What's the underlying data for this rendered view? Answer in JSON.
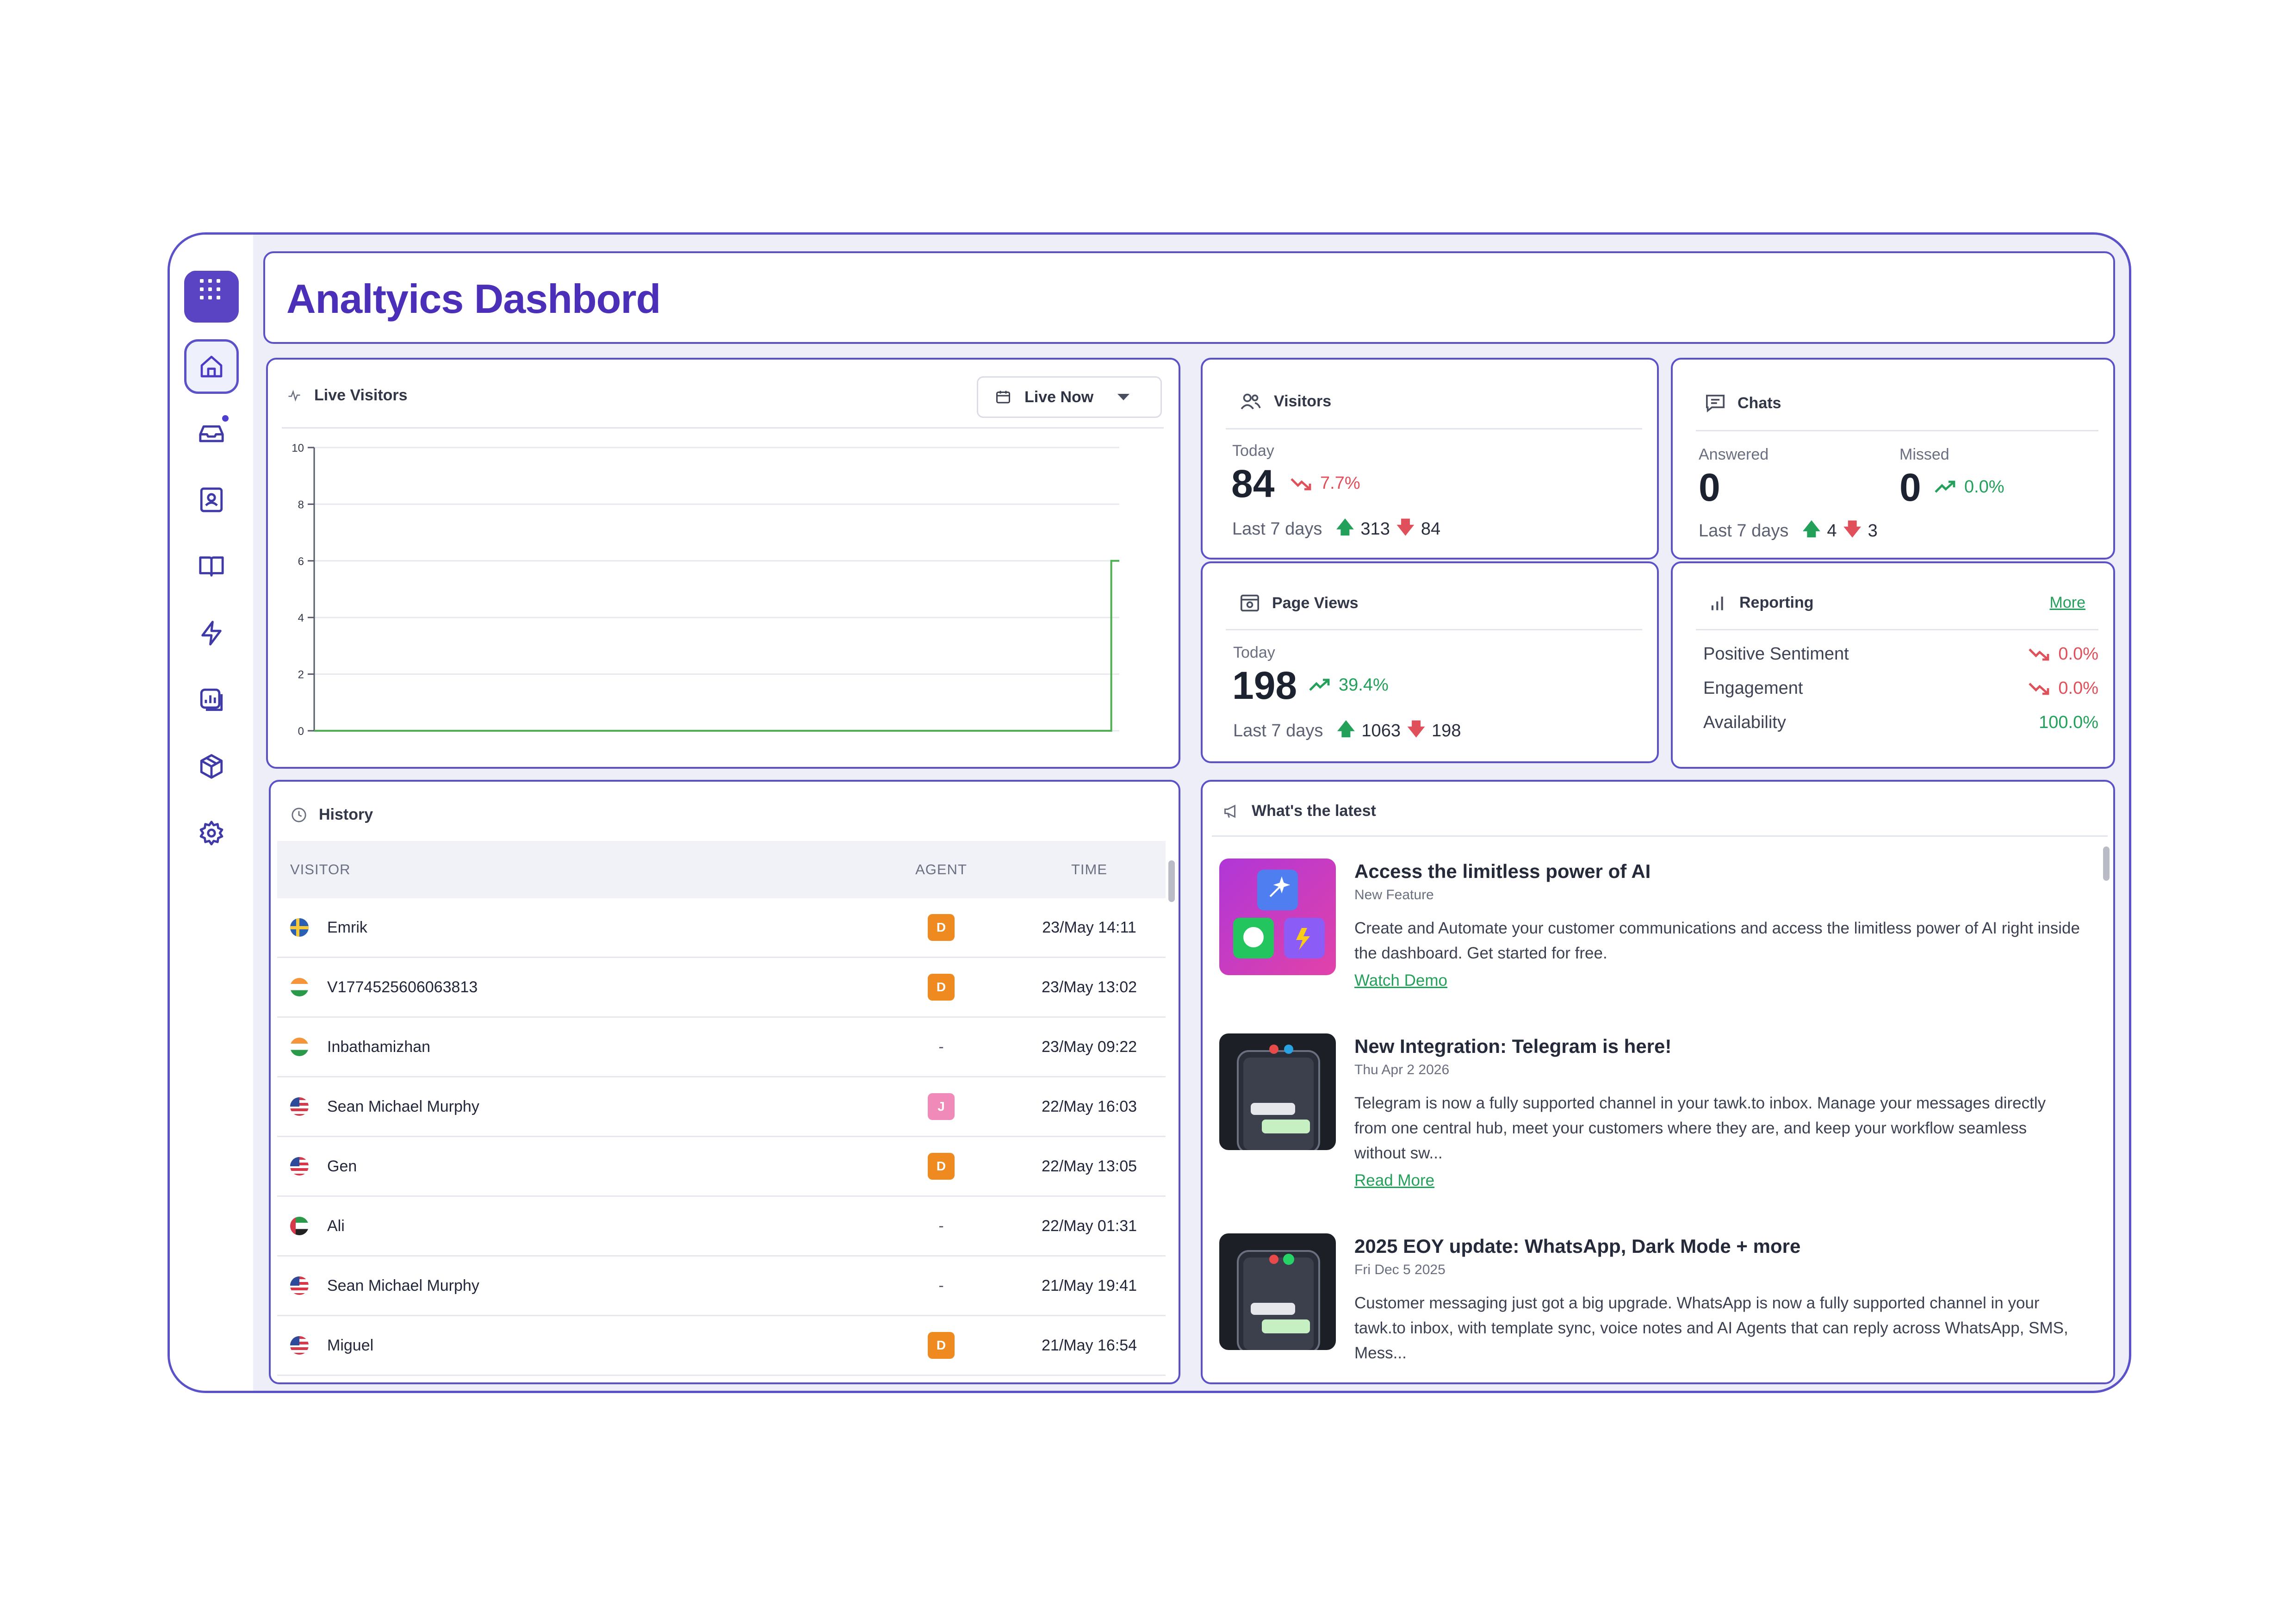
{
  "app": {
    "title": "Analtyics Dashbord"
  },
  "colors": {
    "accent": "#5b51c9",
    "title": "#4b2fb8",
    "up": "#23a05a",
    "down": "#e0505a",
    "badge_d": "#ee8a1f",
    "badge_j": "#f08ab8"
  },
  "sidebar": {
    "items": [
      {
        "icon": "home-icon",
        "active": true
      },
      {
        "icon": "inbox-icon",
        "notification": true
      },
      {
        "icon": "contacts-icon"
      },
      {
        "icon": "knowledge-base-icon"
      },
      {
        "icon": "automation-icon"
      },
      {
        "icon": "reports-icon"
      },
      {
        "icon": "add-ons-icon"
      },
      {
        "icon": "settings-icon"
      }
    ]
  },
  "live_visitors": {
    "title": "Live Visitors",
    "filter_label": "Live Now",
    "chart_data": {
      "type": "line",
      "title": "",
      "xlabel": "",
      "ylabel": "",
      "ylim": [
        0,
        10
      ],
      "y_ticks": [
        "0",
        "2",
        "4",
        "6",
        "8",
        "10"
      ],
      "grid": true,
      "series": [
        {
          "color": "#4caf50",
          "points": [
            [
              0,
              0
            ],
            [
              0.99,
              0
            ],
            [
              0.99,
              6
            ],
            [
              1,
              6
            ]
          ]
        }
      ]
    }
  },
  "visitors": {
    "title": "Visitors",
    "today_label": "Today",
    "today_value": "84",
    "today_change": "7.7%",
    "last7_label": "Last 7 days",
    "last7_up": "313",
    "last7_down": "84"
  },
  "chats": {
    "title": "Chats",
    "answered_label": "Answered",
    "answered_value": "0",
    "missed_label": "Missed",
    "missed_value": "0",
    "missed_change": "0.0%",
    "last7_label": "Last 7 days",
    "last7_up": "4",
    "last7_down": "3"
  },
  "page_views": {
    "title": "Page Views",
    "today_label": "Today",
    "today_value": "198",
    "today_change": "39.4%",
    "last7_label": "Last 7 days",
    "last7_up": "1063",
    "last7_down": "198"
  },
  "reporting": {
    "title": "Reporting",
    "more_label": "More",
    "rows": [
      {
        "label": "Positive Sentiment",
        "value": "0.0%"
      },
      {
        "label": "Engagement",
        "value": "0.0%"
      },
      {
        "label": "Availability",
        "value": "100.0%"
      }
    ]
  },
  "history": {
    "title": "History",
    "columns": {
      "visitor": "VISITOR",
      "agent": "AGENT",
      "time": "TIME"
    },
    "rows": [
      {
        "visitor": "Emrik",
        "flag": "se",
        "agent": "D",
        "time": "23/May 14:11"
      },
      {
        "visitor": "V1774525606063813",
        "flag": "in",
        "agent": "D",
        "time": "23/May 13:02"
      },
      {
        "visitor": "Inbathamizhan",
        "flag": "in",
        "agent": "-",
        "time": "23/May 09:22"
      },
      {
        "visitor": "Sean Michael Murphy",
        "flag": "us",
        "agent": "J",
        "time": "22/May 16:03"
      },
      {
        "visitor": "Gen",
        "flag": "us",
        "agent": "D",
        "time": "22/May 13:05"
      },
      {
        "visitor": "Ali",
        "flag": "ae",
        "agent": "-",
        "time": "22/May 01:31"
      },
      {
        "visitor": "Sean Michael Murphy",
        "flag": "us",
        "agent": "-",
        "time": "21/May 19:41"
      },
      {
        "visitor": "Miguel",
        "flag": "us",
        "agent": "D",
        "time": "21/May 16:54"
      }
    ]
  },
  "latest": {
    "title": "What's the latest",
    "items": [
      {
        "title": "Access the limitless power of AI",
        "subtitle": "New Feature",
        "body": "Create and Automate your customer communications and access the limitless power of AI right inside the dashboard. Get started for free.",
        "link": "Watch Demo"
      },
      {
        "title": "New Integration: Telegram is here!",
        "subtitle": "Thu Apr 2 2026",
        "body": "Telegram is now a fully supported channel in your tawk.to inbox. Manage your messages directly from one central hub, meet your customers where they are, and keep your workflow seamless without sw...",
        "link": "Read More"
      },
      {
        "title": "2025 EOY update: WhatsApp, Dark Mode + more",
        "subtitle": "Fri Dec 5 2025",
        "body": "Customer messaging just got a big upgrade. WhatsApp is now a fully supported channel in your tawk.to inbox, with template sync, voice notes and AI Agents that can reply across WhatsApp, SMS, Mess..."
      }
    ]
  }
}
